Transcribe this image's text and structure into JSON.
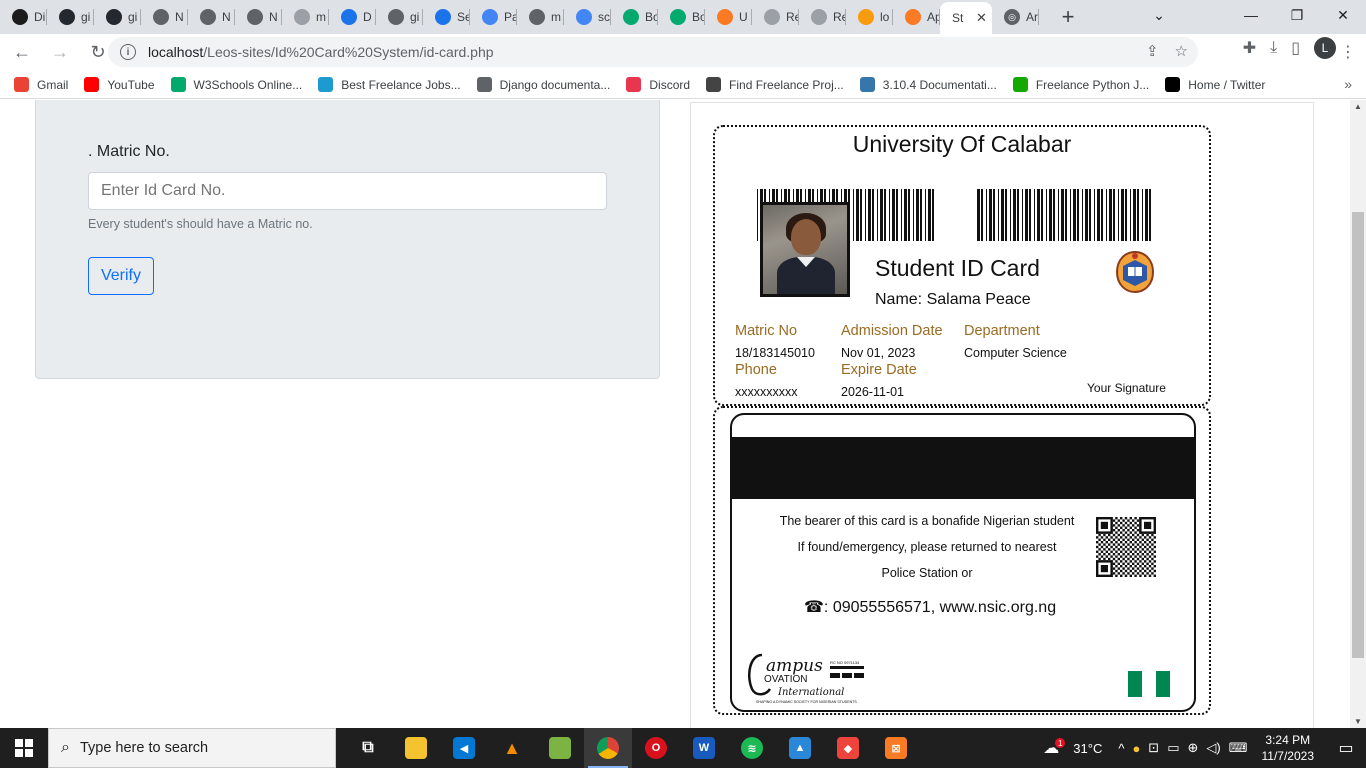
{
  "browser": {
    "tabs": [
      {
        "label": "Di",
        "icon": "dribbble-like-icon",
        "color": "#1c1c1c"
      },
      {
        "label": "gi",
        "icon": "github-icon",
        "color": "#24292f"
      },
      {
        "label": "gi",
        "icon": "github-icon",
        "color": "#24292f"
      },
      {
        "label": "N",
        "icon": "globe-icon",
        "color": "#5f6368"
      },
      {
        "label": "N",
        "icon": "globe-icon",
        "color": "#5f6368"
      },
      {
        "label": "N",
        "icon": "globe-icon",
        "color": "#5f6368"
      },
      {
        "label": "m",
        "icon": "gmail-icon",
        "color": "#9aa0a6"
      },
      {
        "label": "D",
        "icon": "download-icon",
        "color": "#1a73e8"
      },
      {
        "label": "gi",
        "icon": "globe-icon",
        "color": "#5f6368"
      },
      {
        "label": "Se",
        "icon": "settings-icon",
        "color": "#1a73e8"
      },
      {
        "label": "Pa",
        "icon": "google-icon",
        "color": "#4285f4"
      },
      {
        "label": "m",
        "icon": "globe-icon",
        "color": "#5f6368"
      },
      {
        "label": "sc",
        "icon": "google-icon",
        "color": "#4285f4"
      },
      {
        "label": "Bo",
        "icon": "w3schools-icon",
        "color": "#04aa6d"
      },
      {
        "label": "Bo",
        "icon": "w3schools-icon",
        "color": "#04aa6d"
      },
      {
        "label": "U",
        "icon": "xampp-icon",
        "color": "#fb7a24"
      },
      {
        "label": "Re",
        "icon": "page-icon",
        "color": "#9aa0a6"
      },
      {
        "label": "Re",
        "icon": "page-icon",
        "color": "#9aa0a6"
      },
      {
        "label": "lo",
        "icon": "phpmyadmin-icon",
        "color": "#f89c0e"
      },
      {
        "label": "Ap",
        "icon": "xampp-icon",
        "color": "#fb7a24"
      }
    ],
    "active_tab": {
      "label": "St",
      "close": "✕"
    },
    "last_tab": {
      "label": "Ar",
      "icon": "globe-icon"
    },
    "new_tab": "+",
    "url_host": "localhost",
    "url_path": "/Leos-sites/Id%20Card%20System/id-card.php",
    "profile_initial": "L",
    "bookmarks": [
      {
        "label": "Gmail",
        "icon": "gmail-icon",
        "color": "#ea4335"
      },
      {
        "label": "YouTube",
        "icon": "youtube-icon",
        "color": "#ff0000"
      },
      {
        "label": "W3Schools Online...",
        "icon": "w3schools-icon",
        "color": "#04aa6d"
      },
      {
        "label": "Best Freelance Jobs...",
        "icon": "freelance-icon",
        "color": "#1d9bd1"
      },
      {
        "label": "Django documenta...",
        "icon": "globe-icon",
        "color": "#5f6368"
      },
      {
        "label": "Discord",
        "icon": "discord-icon",
        "color": "#e8364e"
      },
      {
        "label": "Find Freelance Proj...",
        "icon": "freelancer-icon",
        "color": "#444"
      },
      {
        "label": "3.10.4 Documentati...",
        "icon": "python-icon",
        "color": "#3776ab"
      },
      {
        "label": "Freelance Python J...",
        "icon": "upwork-icon",
        "color": "#14a800"
      },
      {
        "label": "Home / Twitter",
        "icon": "x-twitter-icon",
        "color": "#000"
      }
    ]
  },
  "form": {
    "label": ". Matric No.",
    "placeholder": "Enter Id Card No.",
    "help": "Every student's should have a Matric no.",
    "button": "Verify"
  },
  "card_front": {
    "university": "University Of Calabar",
    "title": "Student ID Card",
    "name": "Name: Salama Peace",
    "fields": {
      "matric_label": "Matric No",
      "matric_value": "18/183145010",
      "admission_label": "Admission Date",
      "admission_value": "Nov 01, 2023",
      "department_label": "Department",
      "department_value": "Computer Science",
      "phone_label": "Phone",
      "phone_value": "xxxxxxxxxx",
      "expire_label": "Expire Date",
      "expire_value": "2026-11-01"
    },
    "signature": "Your Signature"
  },
  "card_back": {
    "line1": "The bearer of this card is a bonafide Nigerian student",
    "line2": "If found/emergency, please returned to nearest",
    "line3": "Police Station or",
    "contact": "☎: 09055556571, www.nsic.org.ng",
    "logo_text": "Campus Ovation International",
    "logo_small": "RC NO 0971134",
    "logo_tagline": "SHAPING A DYNAMIC SOCIETY FOR NIGERIAN STUDENTS"
  },
  "taskbar": {
    "search_placeholder": "Type here to search",
    "weather": "31°C",
    "time": "3:24 PM",
    "date": "11/7/2023",
    "weather_badge": "1"
  },
  "colors": {
    "field_label": "#9a6b22",
    "flag_green": "#008751",
    "verify_blue": "#0d6efd"
  }
}
